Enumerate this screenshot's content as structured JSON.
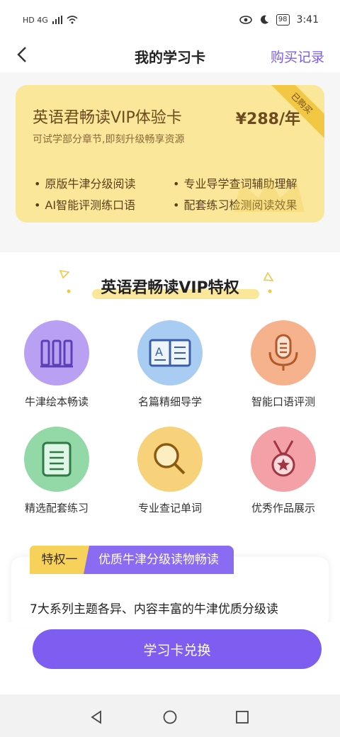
{
  "status_bar": {
    "left_indicators": "HD 4G",
    "time": "3:41",
    "battery": "98"
  },
  "navbar": {
    "title": "我的学习卡",
    "action": "购买记录"
  },
  "vip_card": {
    "title": "英语君畅读VIP体验卡",
    "price": "¥288/年",
    "subtitle": "可试学部分章节,即刻升级畅享资源",
    "ribbon": "已购买",
    "features": [
      "原版牛津分级阅读",
      "专业导学查词辅助理解",
      "AI智能评测练口语",
      "配套练习检测阅读效果"
    ]
  },
  "privileges": {
    "section_title": "英语君畅读VIP特权",
    "items": [
      {
        "label": "牛津绘本畅读",
        "icon": "books-icon",
        "color": "#b9a0f3"
      },
      {
        "label": "名篇精细导学",
        "icon": "open-book-icon",
        "color": "#a9ccf3"
      },
      {
        "label": "智能口语评测",
        "icon": "microphone-icon",
        "color": "#f5b28c"
      },
      {
        "label": "精选配套练习",
        "icon": "document-icon",
        "color": "#93d9a7"
      },
      {
        "label": "专业查记单词",
        "icon": "magnifier-icon",
        "color": "#f7d27a"
      },
      {
        "label": "优秀作品展示",
        "icon": "medal-icon",
        "color": "#f3a0a6"
      }
    ]
  },
  "privilege_detail": {
    "tag_number": "特权一",
    "tag_title": "优质牛津分级读物畅读",
    "description": "7大系列主题各异、内容丰富的牛津优质分级读"
  },
  "cta": {
    "label": "学习卡兑换"
  },
  "colors": {
    "accent": "#7d5ef0",
    "card_bg": "#fbe79a"
  }
}
